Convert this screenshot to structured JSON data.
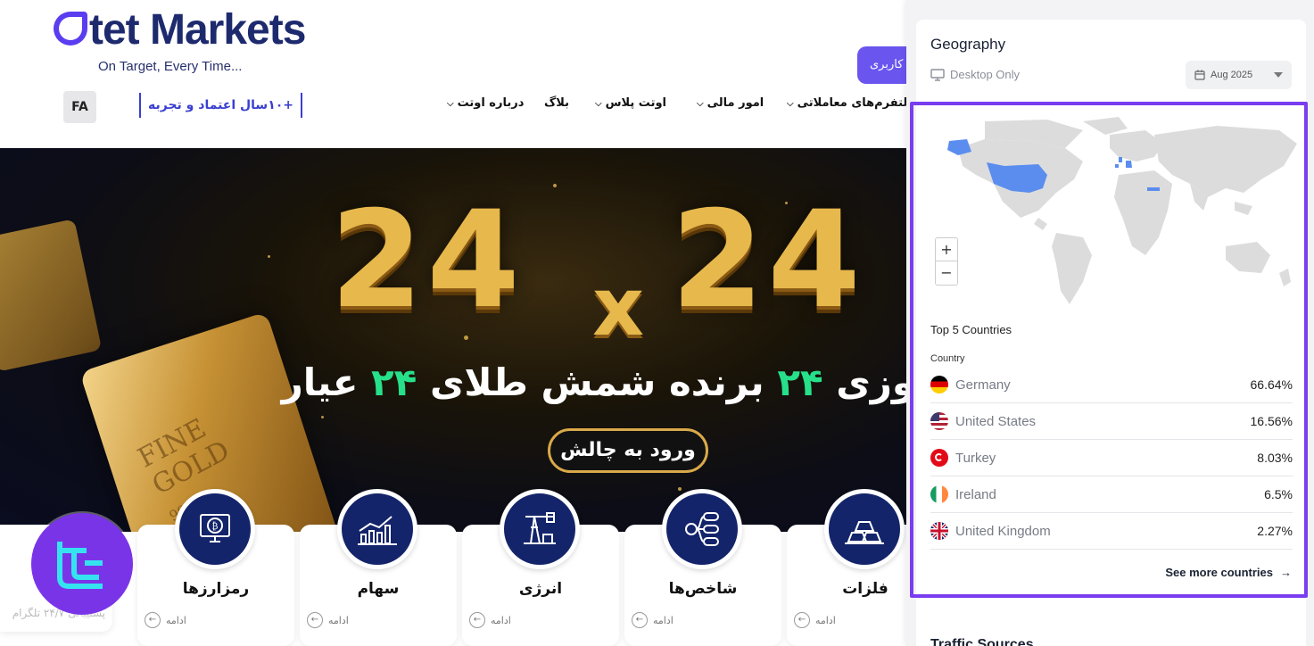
{
  "site": {
    "logo_word": "tet Markets",
    "logo_prefix": "O",
    "logo_tagline": "On Target, Every Time...",
    "login_button": "کاربری",
    "lang_button": "FA",
    "trust_badge": "+۱۰سال اعتماد و تجربه",
    "nav": [
      {
        "label": "پلتفرم‌های معاملاتی",
        "has_dropdown": true
      },
      {
        "label": "امور مالی",
        "has_dropdown": true
      },
      {
        "label": "اوتت پلاس",
        "has_dropdown": true
      },
      {
        "label": "بلاگ",
        "has_dropdown": false
      },
      {
        "label": "درباره اوتت",
        "has_dropdown": true
      }
    ],
    "banner": {
      "big_left": "24",
      "big_x": "x",
      "big_right": "24",
      "headline_pre": "وزی",
      "headline_num": "۲۴",
      "headline_post": "برنده شمش طلای",
      "headline_num2": "۲۴",
      "headline_end": "عیار",
      "cta": "ورود به چالش",
      "bar_engraving": "FINE\nGOLD\n999.9"
    },
    "categories": [
      {
        "title": "رمزارزها",
        "more": "ادامه",
        "icon": "crypto-monitor-icon"
      },
      {
        "title": "سهام",
        "more": "ادامه",
        "icon": "stocks-chart-icon"
      },
      {
        "title": "انرژی",
        "more": "ادامه",
        "icon": "oil-pump-icon"
      },
      {
        "title": "شاخص‌ها",
        "more": "ادامه",
        "icon": "indices-network-icon"
      },
      {
        "title": "فلزات",
        "more": "ادامه",
        "icon": "gold-bars-icon"
      }
    ],
    "support_text": "پشتیبانی ۲۴/۷ تلگرام"
  },
  "geography": {
    "title": "Geography",
    "device": "Desktop Only",
    "date": "Aug 2025",
    "top_label": "Top 5 Countries",
    "column_header": "Country",
    "countries": [
      {
        "name": "Germany",
        "value": "66.64%",
        "flag": "de"
      },
      {
        "name": "United States",
        "value": "16.56%",
        "flag": "us"
      },
      {
        "name": "Turkey",
        "value": "8.03%",
        "flag": "tr"
      },
      {
        "name": "Ireland",
        "value": "6.5%",
        "flag": "ie"
      },
      {
        "name": "United Kingdom",
        "value": "2.27%",
        "flag": "gb"
      }
    ],
    "see_more": "See more countries",
    "zoom_in": "+",
    "zoom_out": "−"
  },
  "traffic": {
    "title": "Traffic Sources"
  },
  "colors": {
    "accent": "#6a55ef",
    "highlight": "#7a3df0",
    "map_highlight": "#5b8def",
    "navy": "#13246a"
  }
}
